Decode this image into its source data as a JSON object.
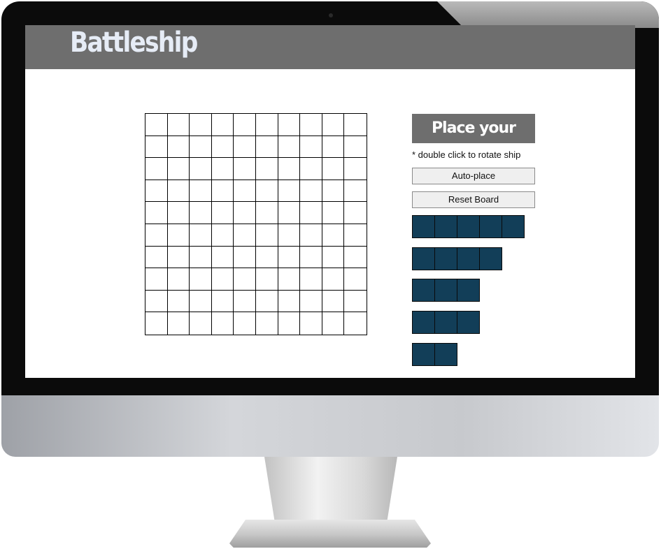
{
  "app": {
    "title": "Battleship"
  },
  "board": {
    "rows": 10,
    "cols": 10
  },
  "panel": {
    "title": "Place your ships",
    "hint": "* double click to rotate ship",
    "auto_place_label": "Auto-place",
    "reset_label": "Reset Board"
  },
  "ships": [
    {
      "length": 5
    },
    {
      "length": 4
    },
    {
      "length": 3
    },
    {
      "length": 3
    },
    {
      "length": 2
    }
  ],
  "colors": {
    "header": "#6e6e6e",
    "ship": "#123e58",
    "title_text": "#e6ecf6"
  }
}
